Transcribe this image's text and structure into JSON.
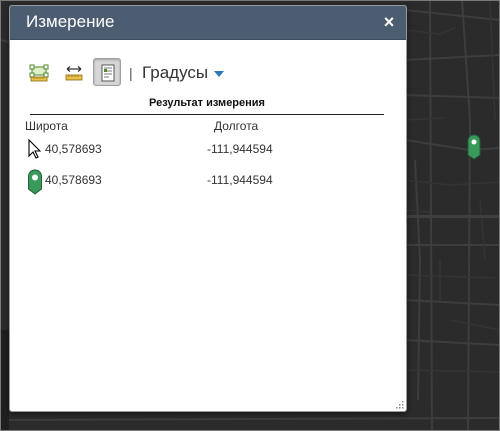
{
  "dialog": {
    "title": "Измерение",
    "close_label": "×"
  },
  "toolbar": {
    "tools": [
      {
        "name": "area",
        "icon": "area-measure-icon"
      },
      {
        "name": "distance",
        "icon": "distance-measure-icon"
      },
      {
        "name": "location",
        "icon": "location-measure-icon",
        "active": true
      }
    ],
    "divider": "|",
    "unit_selected": "Градусы"
  },
  "result": {
    "header": "Результат измерения",
    "columns": [
      "Широта",
      "Долгота"
    ],
    "rows": [
      {
        "icon": "cursor-arrow-icon",
        "lat": "40,578693",
        "lon": "-111,944594"
      },
      {
        "icon": "green-pin-icon",
        "lat": "40,578693",
        "lon": "-111,944594"
      }
    ]
  },
  "colors": {
    "titlebar": "#4d5d71",
    "pin_green": "#3a9a5b",
    "dropdown_arrow": "#2e78b8",
    "map_background": "#2b2b2b"
  }
}
